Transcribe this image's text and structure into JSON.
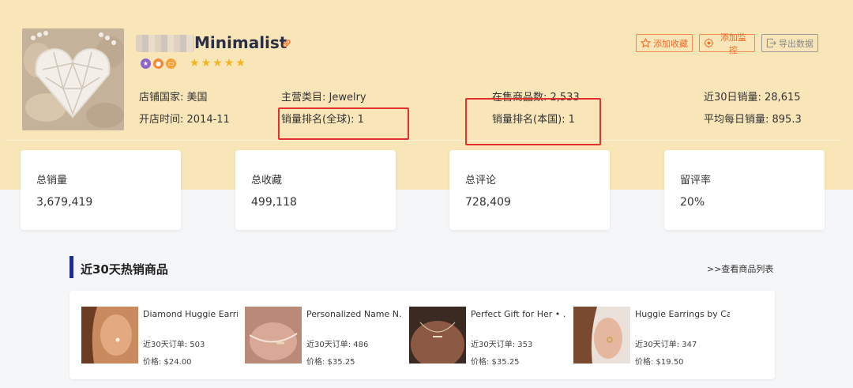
{
  "shop": {
    "name": "Minimalist",
    "stars": [
      "★",
      "★",
      "★",
      "★",
      "★"
    ]
  },
  "actions": {
    "favorite": "添加收藏",
    "monitor": "添加监控",
    "export": "导出数据"
  },
  "info": {
    "country": "店铺国家: 美国",
    "open_time": "开店时间: 2014-11",
    "category": "主营类目: Jewelry",
    "global_rank": "销量排名(全球): 1",
    "on_sale": "在售商品数: 2,533",
    "local_rank": "销量排名(本国): 1",
    "sales_30d": "近30日销量: 28,615",
    "avg_daily": "平均每日销量: 895.3"
  },
  "stats": [
    {
      "label": "总销量",
      "value": "3,679,419"
    },
    {
      "label": "总收藏",
      "value": "499,118"
    },
    {
      "label": "总评论",
      "value": "728,409"
    },
    {
      "label": "留评率",
      "value": "20%"
    }
  ],
  "section": {
    "title": "近30天热销商品",
    "link": ">>查看商品列表"
  },
  "products": [
    {
      "title": "Diamond Huggie Earri…",
      "orders": "近30天订单: 503",
      "price": "价格: $24.00"
    },
    {
      "title": "Personalized Name N…",
      "orders": "近30天订单: 486",
      "price": "价格: $35.25"
    },
    {
      "title": "Perfect Gift for Her • …",
      "orders": "近30天订单: 353",
      "price": "价格: $35.25"
    },
    {
      "title": "Huggie Earrings by Ca…",
      "orders": "近30天订单: 347",
      "price": "价格: $19.50"
    }
  ],
  "colors": {
    "banner": "#f9e6b8",
    "accent_orange": "#ef6a28",
    "highlight_red": "#e2312f",
    "section_bar": "#1c2e8a",
    "star": "#f4b524"
  }
}
